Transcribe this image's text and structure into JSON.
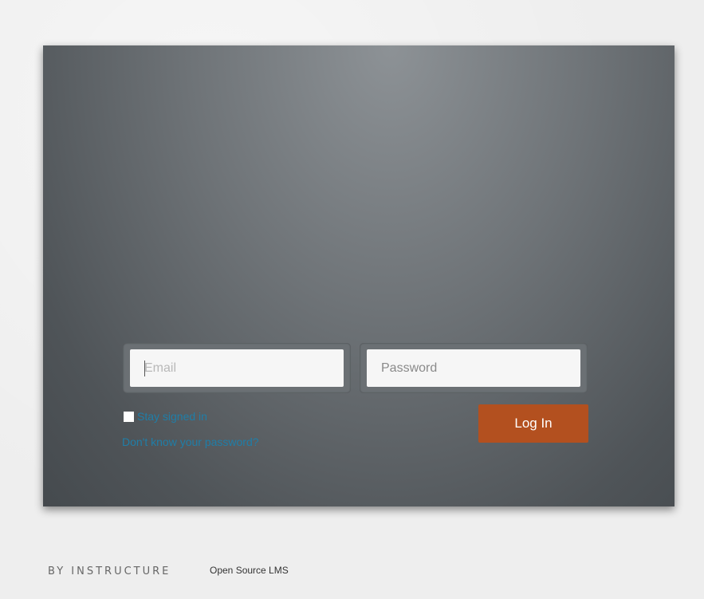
{
  "login": {
    "email_placeholder": "Email",
    "password_placeholder": "Password",
    "remember_label": "Stay signed in",
    "forgot_password_link": "Don't know your password?",
    "login_button": "Log In"
  },
  "footer": {
    "brand": "BY INSTRUCTURE",
    "tagline": "Open Source LMS"
  },
  "colors": {
    "button": "#b3501f",
    "link": "#1f7ea8",
    "panel": "#6f7478"
  }
}
